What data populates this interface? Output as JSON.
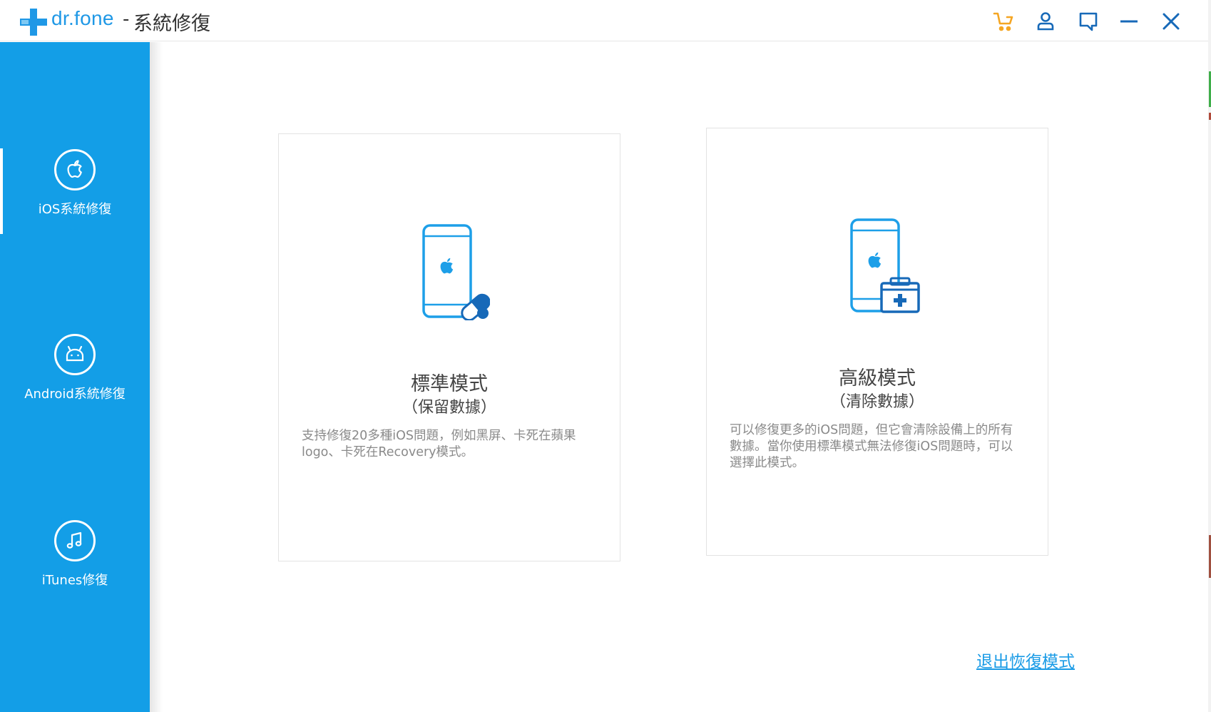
{
  "app": {
    "brand": "dr.fone",
    "separator": "-",
    "title": "系統修復"
  },
  "toolbar": {
    "icons": [
      "cart-icon",
      "user-icon",
      "feedback-icon",
      "minimize-icon",
      "close-icon"
    ]
  },
  "sidebar": {
    "items": [
      {
        "label": "iOS系統修復",
        "icon": "apple-icon"
      },
      {
        "label": "Android系統修復",
        "icon": "android-icon"
      },
      {
        "label": "iTunes修復",
        "icon": "music-note-icon"
      }
    ]
  },
  "cards": [
    {
      "title": "標準模式",
      "subtitle": "（保留數據）",
      "description_lines": [
        "支持修復20多種iOS問題，例如黑屏、卡死在蘋果",
        "logo、卡死在Recovery模式。"
      ],
      "icon": "phone-pill-icon"
    },
    {
      "title": "高級模式",
      "subtitle": "（清除數據）",
      "description_lines": [
        "可以修復更多的iOS問題，但它會清除設備上的所有",
        "數據。當你使用標準模式無法修復iOS問題時，可以",
        "選擇此模式。"
      ],
      "icon": "phone-medkit-icon"
    }
  ],
  "exit_link": "退出恢復模式",
  "colors": {
    "accent": "#139ee7",
    "cart": "#f5a623",
    "icon_dark": "#1769b8",
    "link": "#1a9be6"
  }
}
